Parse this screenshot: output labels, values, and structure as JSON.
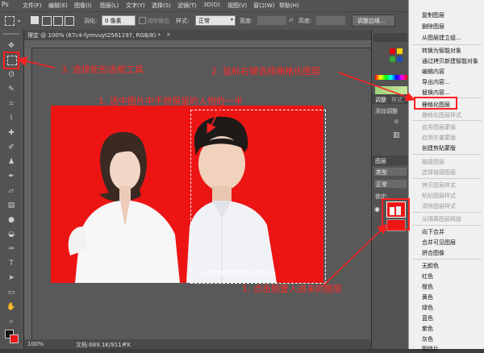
{
  "menubar": {
    "items": [
      "文件(F)",
      "编辑(E)",
      "图像(I)",
      "图层(L)",
      "文字(Y)",
      "选择(S)",
      "滤镜(T)",
      "3D(D)",
      "视图(V)",
      "窗口(W)",
      "帮助(H)"
    ]
  },
  "options": {
    "feather_label": "羽化:",
    "feather_value": "0 像素",
    "antialias_label": "消除锯齿",
    "style_label": "样式:",
    "style_value": "正常",
    "width_label": "宽度:",
    "height_label": "高度:",
    "refine_button": "调整边缘..."
  },
  "document": {
    "tab_title": "理定 @ 100% (67c4-fymvuyt2561197, RGB/8) *",
    "zoom": "100%",
    "doc_info": "文档:689.1K/911.7K",
    "watermark": "@南方都市报微博@搜狐娱乐"
  },
  "panels": {
    "adjust_tab": "调整",
    "style_tab": "样式",
    "add_adjust": "添加调整",
    "layers_tab": "图层",
    "kind_label": "类型",
    "blend_mode": "正常",
    "lock_label": "锁定:"
  },
  "context_menu": {
    "items": [
      {
        "label": "复制图层",
        "disabled": false
      },
      {
        "label": "删除图层",
        "disabled": false
      },
      {
        "label": "从图层建立组...",
        "disabled": false
      },
      {
        "label": "转换为智能对象",
        "disabled": false
      },
      {
        "label": "通过拷贝新建智能对象",
        "disabled": false
      },
      {
        "label": "编辑内容",
        "disabled": false
      },
      {
        "label": "导出内容...",
        "disabled": false
      },
      {
        "label": "替换内容...",
        "disabled": false
      },
      {
        "label": "栅格化图层",
        "disabled": false
      },
      {
        "label": "栅格化图层样式",
        "disabled": true
      },
      {
        "label": "启用图层蒙版",
        "disabled": true
      },
      {
        "label": "启用矢量蒙版",
        "disabled": true
      },
      {
        "label": "创建剪贴蒙版",
        "disabled": false
      },
      {
        "label": "链接图层",
        "disabled": true
      },
      {
        "label": "选择链接图层",
        "disabled": true
      },
      {
        "label": "拷贝图层样式",
        "disabled": true
      },
      {
        "label": "粘贴图层样式",
        "disabled": true
      },
      {
        "label": "清除图层样式",
        "disabled": true
      },
      {
        "label": "从隔离图层释放",
        "disabled": true
      },
      {
        "label": "向下合并",
        "disabled": false
      },
      {
        "label": "合并可见图层",
        "disabled": false
      },
      {
        "label": "拼合图像",
        "disabled": false
      },
      {
        "label": "无颜色",
        "disabled": false
      },
      {
        "label": "红色",
        "disabled": false
      },
      {
        "label": "橙色",
        "disabled": false
      },
      {
        "label": "黄色",
        "disabled": false
      },
      {
        "label": "绿色",
        "disabled": false
      },
      {
        "label": "蓝色",
        "disabled": false
      },
      {
        "label": "紫色",
        "disabled": false
      },
      {
        "label": "灰色",
        "disabled": false
      },
      {
        "label": "明信片",
        "disabled": false
      }
    ]
  },
  "annotations": {
    "step1": "1. 选中图片中不想保留的人物的一半",
    "step1b": "1. 点击刚置入进来的图层",
    "step2": "2. 鼠标右键选择栅格化图层",
    "step3": "3. 选择矩形选框工具"
  },
  "colors": {
    "photo_background": "#ed1414",
    "annotation": "#ff2a2a"
  }
}
